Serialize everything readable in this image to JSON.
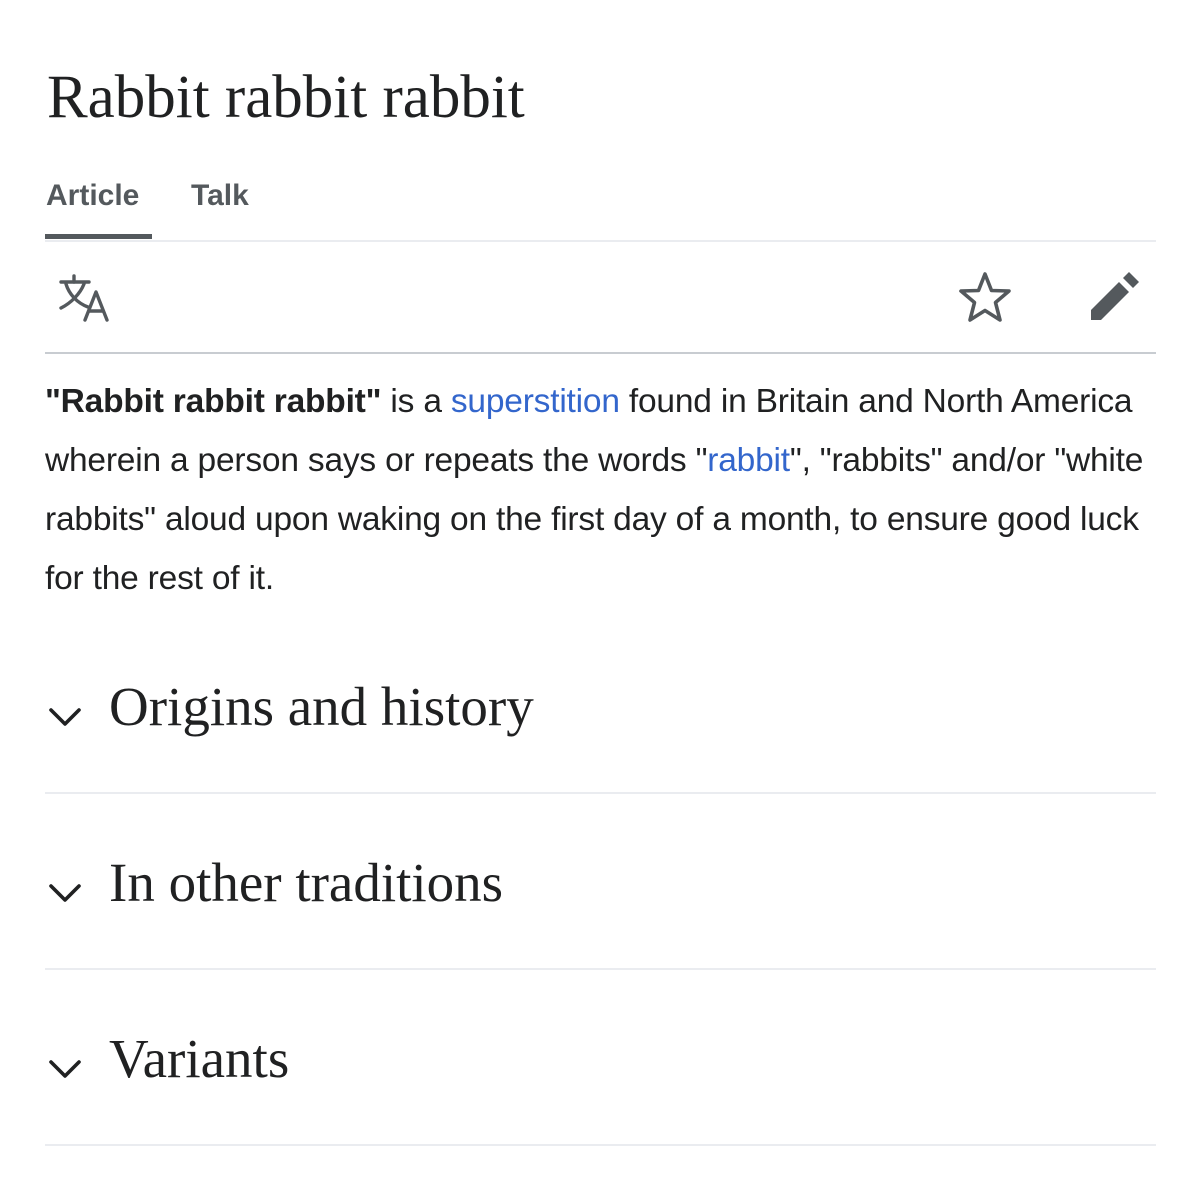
{
  "page": {
    "title": "Rabbit rabbit rabbit"
  },
  "tabs": [
    {
      "label": "Article",
      "selected": true
    },
    {
      "label": "Talk",
      "selected": false
    }
  ],
  "toolbar": {
    "icons": [
      "language-icon",
      "star-icon",
      "edit-pencil-icon"
    ]
  },
  "intro": {
    "bold_term": "\"Rabbit rabbit rabbit\"",
    "text_1": " is a ",
    "link_superstition": "superstition",
    "text_2": " found in Britain and North America wherein a person says or repeats the words \"",
    "link_rabbit": "rabbit",
    "text_3": "\", \"rabbits\" and/or \"white rabbits\" aloud upon waking on the first day of a month, to ensure good luck for the rest of it."
  },
  "sections": [
    {
      "heading": "Origins and history"
    },
    {
      "heading": "In other traditions"
    },
    {
      "heading": "Variants"
    }
  ],
  "colors": {
    "text": "#202122",
    "link": "#3366cc",
    "tab_text": "#54595d",
    "divider": "#eaecf0",
    "toolbar_divider": "#c8ccd1"
  }
}
